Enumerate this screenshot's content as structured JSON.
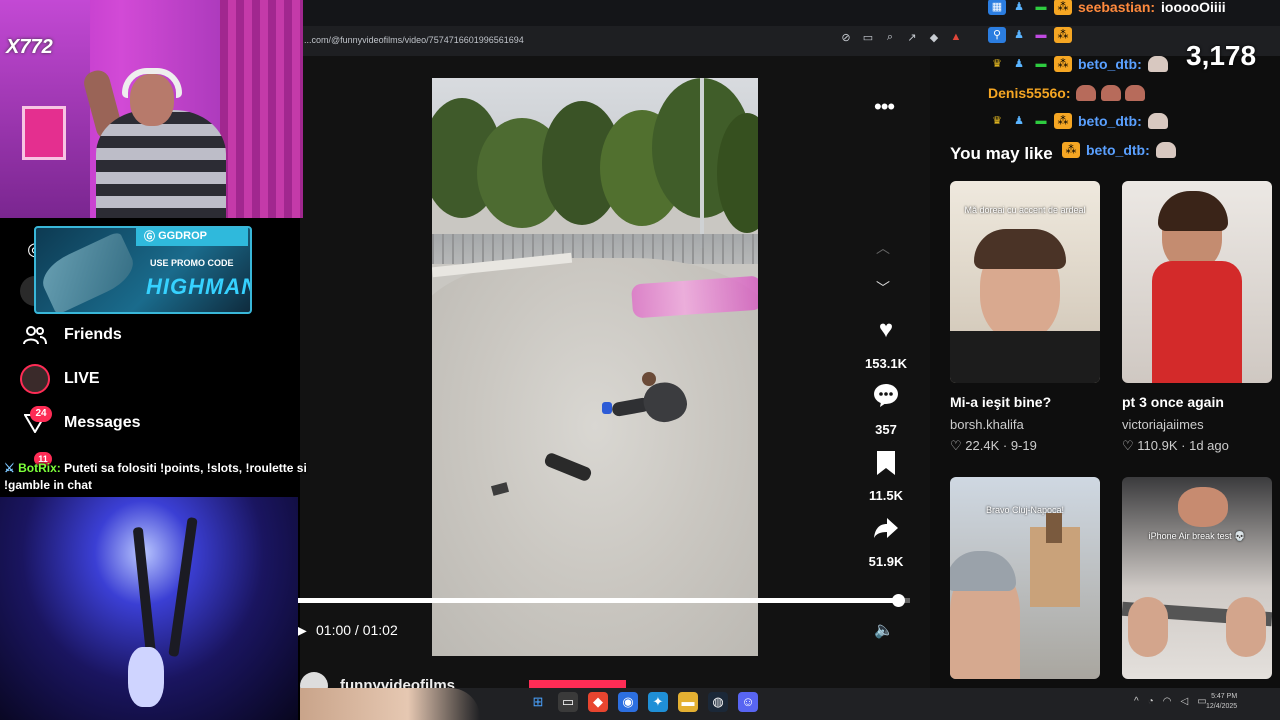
{
  "browser": {
    "url": "...com/@funnyvideofilms/video/7574716601996561694"
  },
  "video": {
    "time_current": "01:00",
    "time_total": "01:02",
    "time_separator": " / ",
    "progress": 0.98,
    "likes": "153.1K",
    "comments": "357",
    "saves": "11.5K",
    "shares": "51.9K",
    "author": "funnyvideofilms"
  },
  "sidebar": {
    "heading_visible": "You may like",
    "recommendations": [
      {
        "title": "Mi-a ieşit bine?",
        "author": "borsh.khalifa",
        "likes": "22.4K",
        "date": "9-19",
        "overlay": "Mă doreai cu accent de ardeal"
      },
      {
        "title": "pt 3 once again",
        "author": "victoriajaiimes",
        "likes": "110.9K",
        "date": "1d ago",
        "overlay": ""
      },
      {
        "title": "",
        "author": "",
        "likes": "",
        "date": "",
        "overlay": "Bravo Cluj-Napoca!"
      },
      {
        "title": "",
        "author": "",
        "likes": "",
        "date": "",
        "overlay": "iPhone Air break test 💀"
      }
    ]
  },
  "left_menu": {
    "items": [
      {
        "label": "Friends",
        "icon": "friends-icon"
      },
      {
        "label": "LIVE",
        "icon": "live-icon"
      },
      {
        "label": "Messages",
        "icon": "messages-icon",
        "badge": "24"
      }
    ],
    "activity_badge": "11"
  },
  "stream": {
    "cam_logo": "X772",
    "viewer_count": "3,178",
    "promo": {
      "brand": "GGDROP",
      "subtitle": "USE PROMO CODE",
      "code": "HIGHMAN"
    },
    "bot_message": {
      "user": "BotRix:",
      "text": " Puteti sa folositi !points, !slots, !roulette si !gamble in chat"
    },
    "chat": [
      {
        "user": "seebastian:",
        "message": "iooooOiiii",
        "color": "#ff8a3d"
      },
      {
        "user": "beto_dtb:",
        "message": "",
        "color": "#5aa0ff"
      },
      {
        "user": "Denis5556o:",
        "message": "",
        "color": "#f5a623"
      },
      {
        "user": "beto_dtb:",
        "message": "",
        "color": "#5aa0ff"
      },
      {
        "user": "beto_dtb:",
        "message": "",
        "color": "#5aa0ff"
      }
    ]
  },
  "taskbar": {
    "time": "5:47 PM",
    "date": "12/4/2025"
  },
  "colors": {
    "tiktok_red": "#fe2c55",
    "promo_cyan": "#2fb9dc",
    "bot_green": "#7cff3a"
  }
}
